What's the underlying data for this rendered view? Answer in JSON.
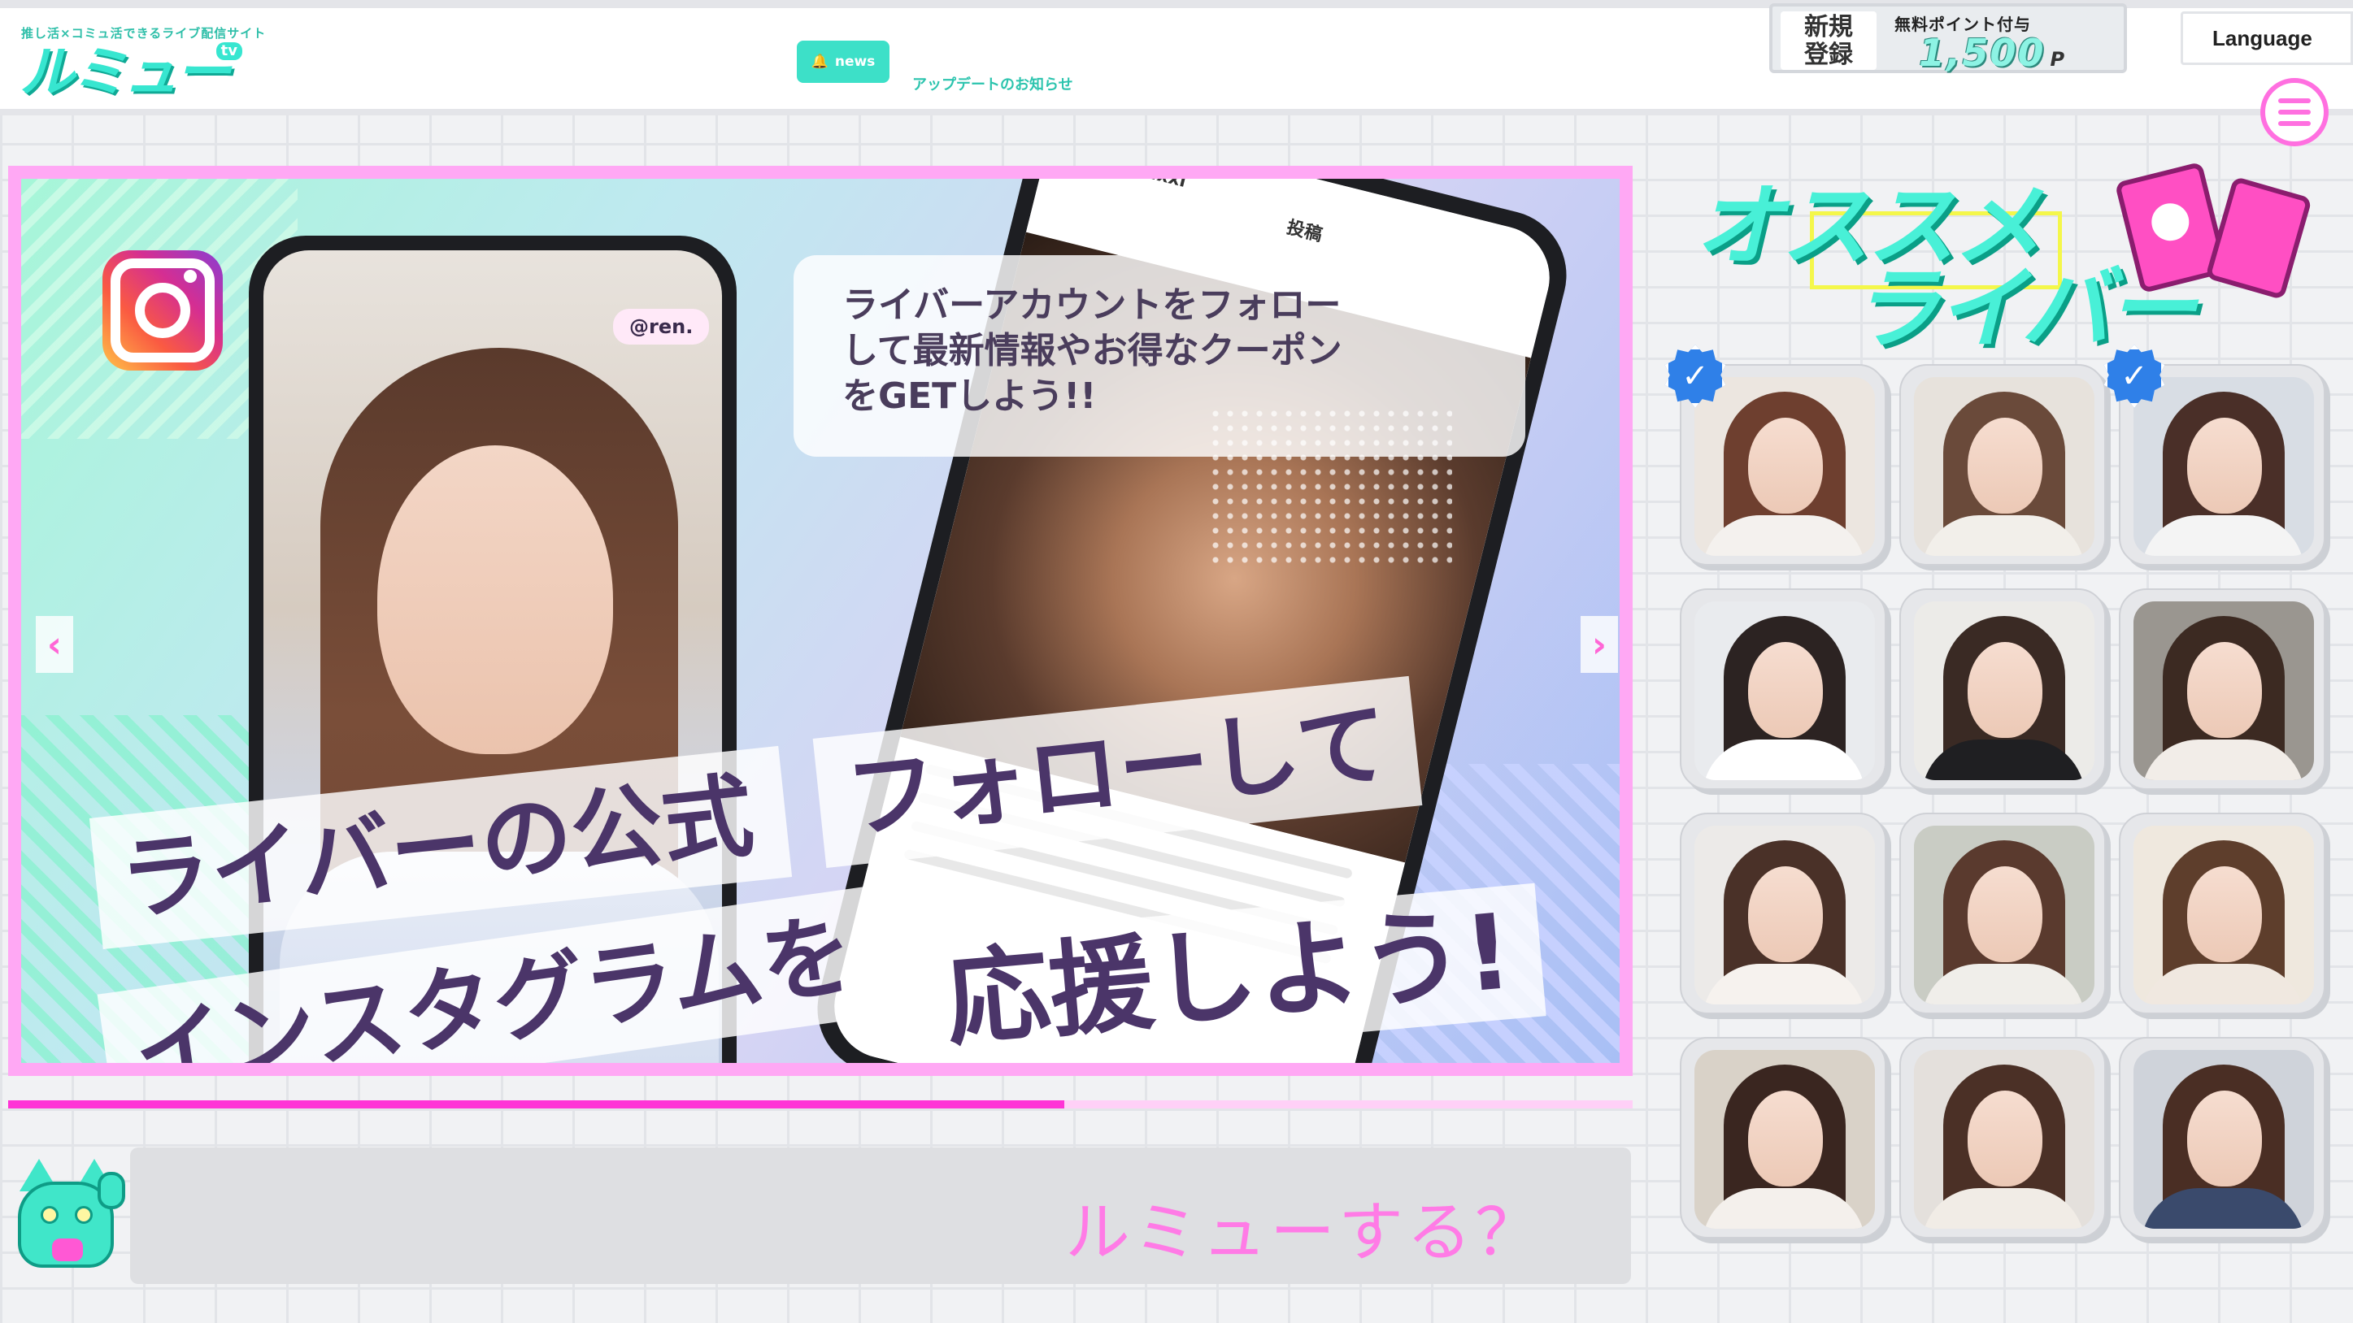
{
  "header": {
    "tagline": "推し活×コミュ活できるライブ配信サイト",
    "logo_text": "ルミュー",
    "logo_sub": "tv",
    "news_button": "news",
    "news_text": "アップデートのお知らせ",
    "signup": {
      "left_label": "新規\n登録",
      "right_label": "無料ポイント付与",
      "points": "1,500",
      "points_unit": "P"
    },
    "language_label": "Language",
    "menu_icon": "hamburger-icon"
  },
  "slider": {
    "instagram_icon": "instagram-icon",
    "handle": "@ren.",
    "phone_user": "ren.xxi",
    "phone_post_label": "投稿",
    "bubble_lines": [
      "ライバーアカウントをフォロー",
      "して最新情報やお得なクーポン",
      "をGETしよう!!"
    ],
    "headline_1": "ライバーの公式",
    "headline_2": "フォローして",
    "headline_3": "インスタグラムを",
    "headline_4": "応援しよう!",
    "prev_label": "‹",
    "next_label": "›",
    "progress": 0.65,
    "colors": {
      "frame": "#ffa8f4",
      "progress_fill": "#ff34d6",
      "headline_text": "#4b3569"
    }
  },
  "bottom": {
    "mascot": "lucky-cat-icon",
    "prompt": "ルミューする？"
  },
  "recommend": {
    "title_line1": "オススメ",
    "title_line2": "ライバー",
    "livers": [
      {
        "verified": true,
        "bg": "#ece6e0",
        "hair": "#6e3f2f",
        "shirt": "#f4f1ee"
      },
      {
        "verified": false,
        "bg": "#e7e2dc",
        "hair": "#6a4a3a",
        "shirt": "#f2efea"
      },
      {
        "verified": true,
        "bg": "#d8dde4",
        "hair": "#4a2f28",
        "shirt": "#f4f4f4"
      },
      {
        "verified": false,
        "bg": "#e9ebee",
        "hair": "#2c2322",
        "shirt": "#ffffff"
      },
      {
        "verified": false,
        "bg": "#ecebe8",
        "hair": "#3a2a24",
        "shirt": "#1f1f22"
      },
      {
        "verified": false,
        "bg": "#9a9690",
        "hair": "#3c2a22",
        "shirt": "#f2ede8"
      },
      {
        "verified": false,
        "bg": "#eceae8",
        "hair": "#4a3128",
        "shirt": "#f6f2ee"
      },
      {
        "verified": false,
        "bg": "#c9ccc4",
        "hair": "#5a3a2e",
        "shirt": "#f0eeea"
      },
      {
        "verified": false,
        "bg": "#efe8de",
        "hair": "#5e3e2c",
        "shirt": "#f0e8e0"
      },
      {
        "verified": false,
        "bg": "#d9d2c8",
        "hair": "#3a2620",
        "shirt": "#f4f0ec"
      },
      {
        "verified": false,
        "bg": "#e4e0dc",
        "hair": "#4b3026",
        "shirt": "#f1ece6"
      },
      {
        "verified": false,
        "bg": "#cfd3da",
        "hair": "#4a2e24",
        "shirt": "#3a4a6c"
      }
    ]
  }
}
